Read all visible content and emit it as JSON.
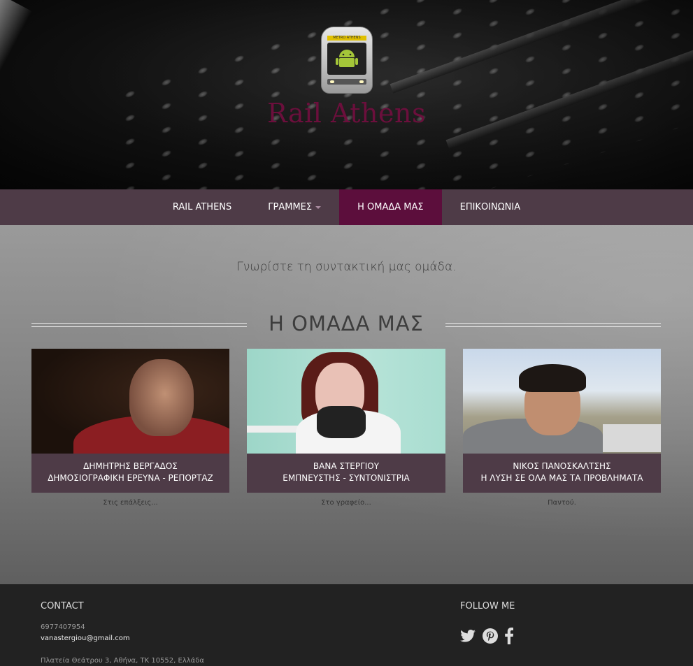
{
  "header": {
    "site_title": "Rail Athens",
    "logo_sign": "METRO ATHENS"
  },
  "nav": {
    "items": [
      {
        "label": "RAIL ATHENS",
        "active": false,
        "dropdown": false
      },
      {
        "label": "ΓΡΑΜΜΕΣ",
        "active": false,
        "dropdown": true
      },
      {
        "label": "Η ΟΜΑΔΑ ΜΑΣ",
        "active": true,
        "dropdown": false
      },
      {
        "label": "ΕΠΙΚΟΙΝΩΝΙΑ",
        "active": false,
        "dropdown": false
      }
    ],
    "active_color": "#5c0e3c",
    "bar_color": "#4e3b47"
  },
  "main": {
    "intro": "Γνωρίστε τη συντακτική μας ομάδα.",
    "section_title": "Η ΟΜΑΔΑ ΜΑΣ",
    "members": [
      {
        "name": "ΔΗΜΗΤΡΗΣ ΒΕΡΓΑΔΟΣ",
        "role": "ΔΗΜΟΣΙΟΓΡΑΦΙΚΗ ΕΡΕΥΝΑ - ΡΕΠΟΡΤΑΖ",
        "note": "Στις επάλξεις..."
      },
      {
        "name": "ΒΑΝΑ ΣΤΕΡΓΙΟΥ",
        "role": "ΕΜΠΝΕΥΣΤΗΣ - ΣΥΝΤΟΝΙΣΤΡΙΑ",
        "note": "Στο γραφείο..."
      },
      {
        "name": "ΝΙΚΟΣ ΠΑΝΟΣΚΑΛΤΣΗΣ",
        "role": "Η ΛΥΣΗ ΣΕ ΟΛΑ ΜΑΣ ΤΑ ΠΡΟΒΛΗΜΑΤΑ",
        "note": "Παντού."
      }
    ]
  },
  "footer": {
    "contact_title": "CONTACT",
    "phone": "6977407954",
    "email": "vanastergiou@gmail.com",
    "address": "Πλατεία Θεάτρου 3, Αθήνα, ΤΚ 10552, Ελλάδα",
    "follow_title": "FOLLOW ME",
    "social_icons": [
      "twitter-icon",
      "pinterest-icon",
      "facebook-icon"
    ]
  }
}
